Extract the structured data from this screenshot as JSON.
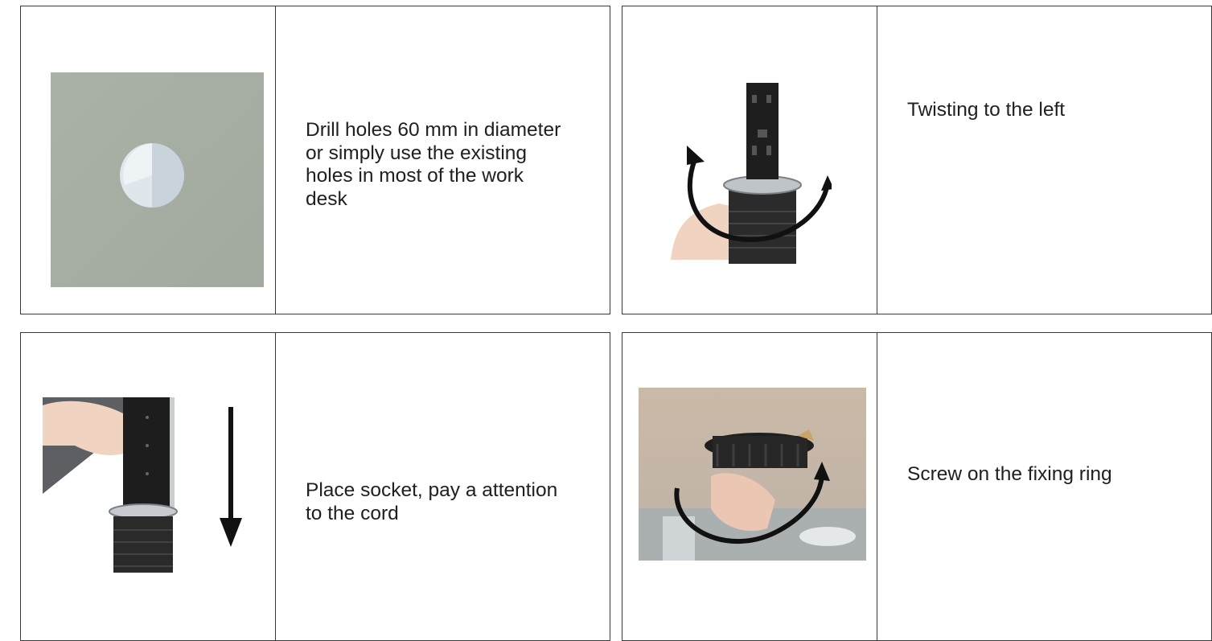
{
  "steps": [
    {
      "caption": "Drill holes 60 mm in diameter or simply use the existing holes in most of the work desk",
      "image": "desk-hole-photo"
    },
    {
      "caption": "Twisting to the left",
      "image": "twist-socket-photo"
    },
    {
      "caption": "Place socket, pay a attention to the cord",
      "image": "place-socket-photo"
    },
    {
      "caption": "Screw on the fixing ring",
      "image": "fixing-ring-photo"
    }
  ]
}
